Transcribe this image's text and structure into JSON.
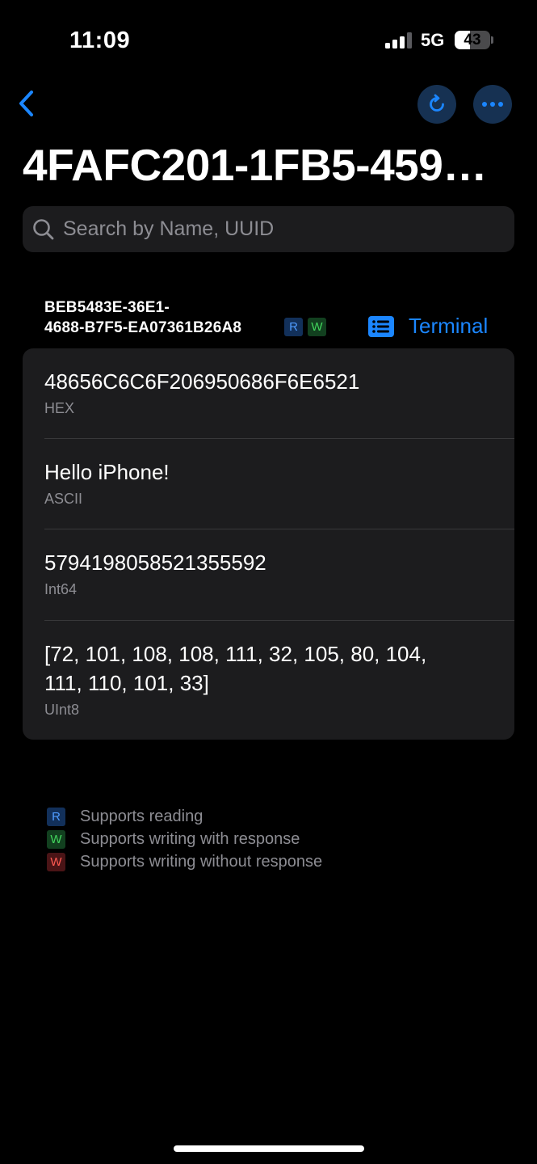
{
  "status_bar": {
    "time": "11:09",
    "network": "5G",
    "battery": "43",
    "battery_level": 0.43
  },
  "nav": {
    "back_icon": "chevron-left-icon",
    "refresh_icon": "refresh-icon",
    "more_icon": "ellipsis-icon",
    "accent_color": "#1b86ff"
  },
  "title": "4FAFC201-1FB5-459…",
  "search": {
    "placeholder": "Search by Name, UUID",
    "value": ""
  },
  "characteristic": {
    "uuid_line1": "BEB5483E-36E1-",
    "uuid_line2": "4688-B7F5-EA07361B26A8",
    "badges": [
      "R",
      "W"
    ],
    "terminal_label": "Terminal"
  },
  "values": [
    {
      "value": "48656C6C6F206950686F6E6521",
      "format": "HEX"
    },
    {
      "value": "Hello iPhone!",
      "format": "ASCII"
    },
    {
      "value": "5794198058521355592",
      "format": "Int64"
    },
    {
      "value": "[72, 101, 108, 108, 111, 32, 105, 80, 104, 111, 110, 101, 33]",
      "format": "UInt8"
    }
  ],
  "legend": [
    {
      "badge": "R",
      "text": "Supports reading",
      "color": "#4f9bff"
    },
    {
      "badge": "W",
      "text": "Supports writing with response",
      "color": "#42d45c"
    },
    {
      "badge": "W",
      "text": "Supports writing without response",
      "color": "#ff5a52"
    }
  ]
}
